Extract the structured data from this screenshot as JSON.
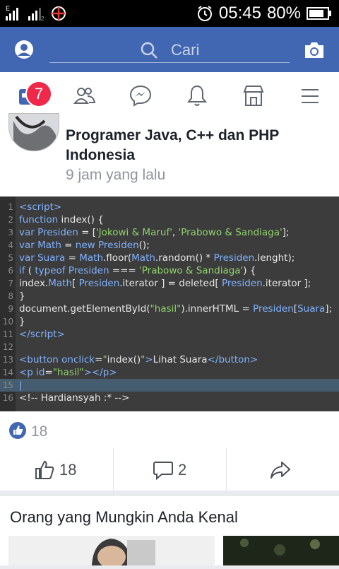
{
  "status": {
    "clock": "05:45",
    "battery": "80%"
  },
  "search": {
    "placeholder": "Cari"
  },
  "nav": {
    "badge": "7"
  },
  "post": {
    "author": "Programer Java, C++ dan PHP Indonesia",
    "time": "9 jam yang lalu",
    "code_lines": [
      {
        "n": "1",
        "html": "<span class='k'>&lt;script&gt;</span>"
      },
      {
        "n": "2",
        "html": "<span class='k'>function</span> index() {"
      },
      {
        "n": "3",
        "html": "<span class='k'>var Presiden</span> = [<span class='s'>'Jokowi &amp; Maruf'</span>, <span class='s'>'Prabowo &amp; Sandiaga'</span>];"
      },
      {
        "n": "4",
        "html": "<span class='k'>var Math</span> = <span class='k'>new Presiden</span>();"
      },
      {
        "n": "5",
        "html": "<span class='k'>var Suara</span> = <span class='k'>Math</span>.floor(<span class='k'>Math</span>.random() * <span class='k'>Presiden</span>.lenght);"
      },
      {
        "n": "6",
        "html": "<span class='k'>if</span> ( <span class='k'>typeof Presiden</span> === <span class='s'>'Prabowo &amp; Sandiaga'</span>) {"
      },
      {
        "n": "7",
        "html": "index.<span class='k'>Math</span>[ <span class='k'>Presiden</span>.iterator ] = deleted[ <span class='k'>Presiden</span>.iterator ];"
      },
      {
        "n": "8",
        "html": "}"
      },
      {
        "n": "9",
        "html": "document.getElementById(<span class='s'>\"hasil\"</span>).innerHTML = <span class='k'>Presiden</span>[<span class='k'>Suara</span>];"
      },
      {
        "n": "10",
        "html": "}"
      },
      {
        "n": "11",
        "html": "<span class='k'>&lt;/script&gt;</span>"
      },
      {
        "n": "12",
        "html": ""
      },
      {
        "n": "13",
        "html": "<span class='k'>&lt;button onclick</span>=<span class='s'>\"</span>index()<span class='s'>\"</span><span class='k'>&gt;</span>Lihat Suara<span class='k'>&lt;/button&gt;</span>"
      },
      {
        "n": "14",
        "html": "<span class='k'>&lt;p id</span>=<span class='s'>\"hasil\"</span><span class='k'>&gt;&lt;/p&gt;</span>"
      },
      {
        "n": "15",
        "html": "<span class='k'>|</span>"
      },
      {
        "n": "16",
        "html": "&lt;!-- Hardiansyah :* --&gt;"
      }
    ],
    "reactions_count": "18",
    "like_count": "18",
    "comment_count": "2"
  },
  "suggest": {
    "title": "Orang yang Mungkin Anda Kenal"
  },
  "colors": {
    "brand": "#4267b2",
    "badge": "#f02849",
    "code_bg": "#3c3c3c"
  }
}
